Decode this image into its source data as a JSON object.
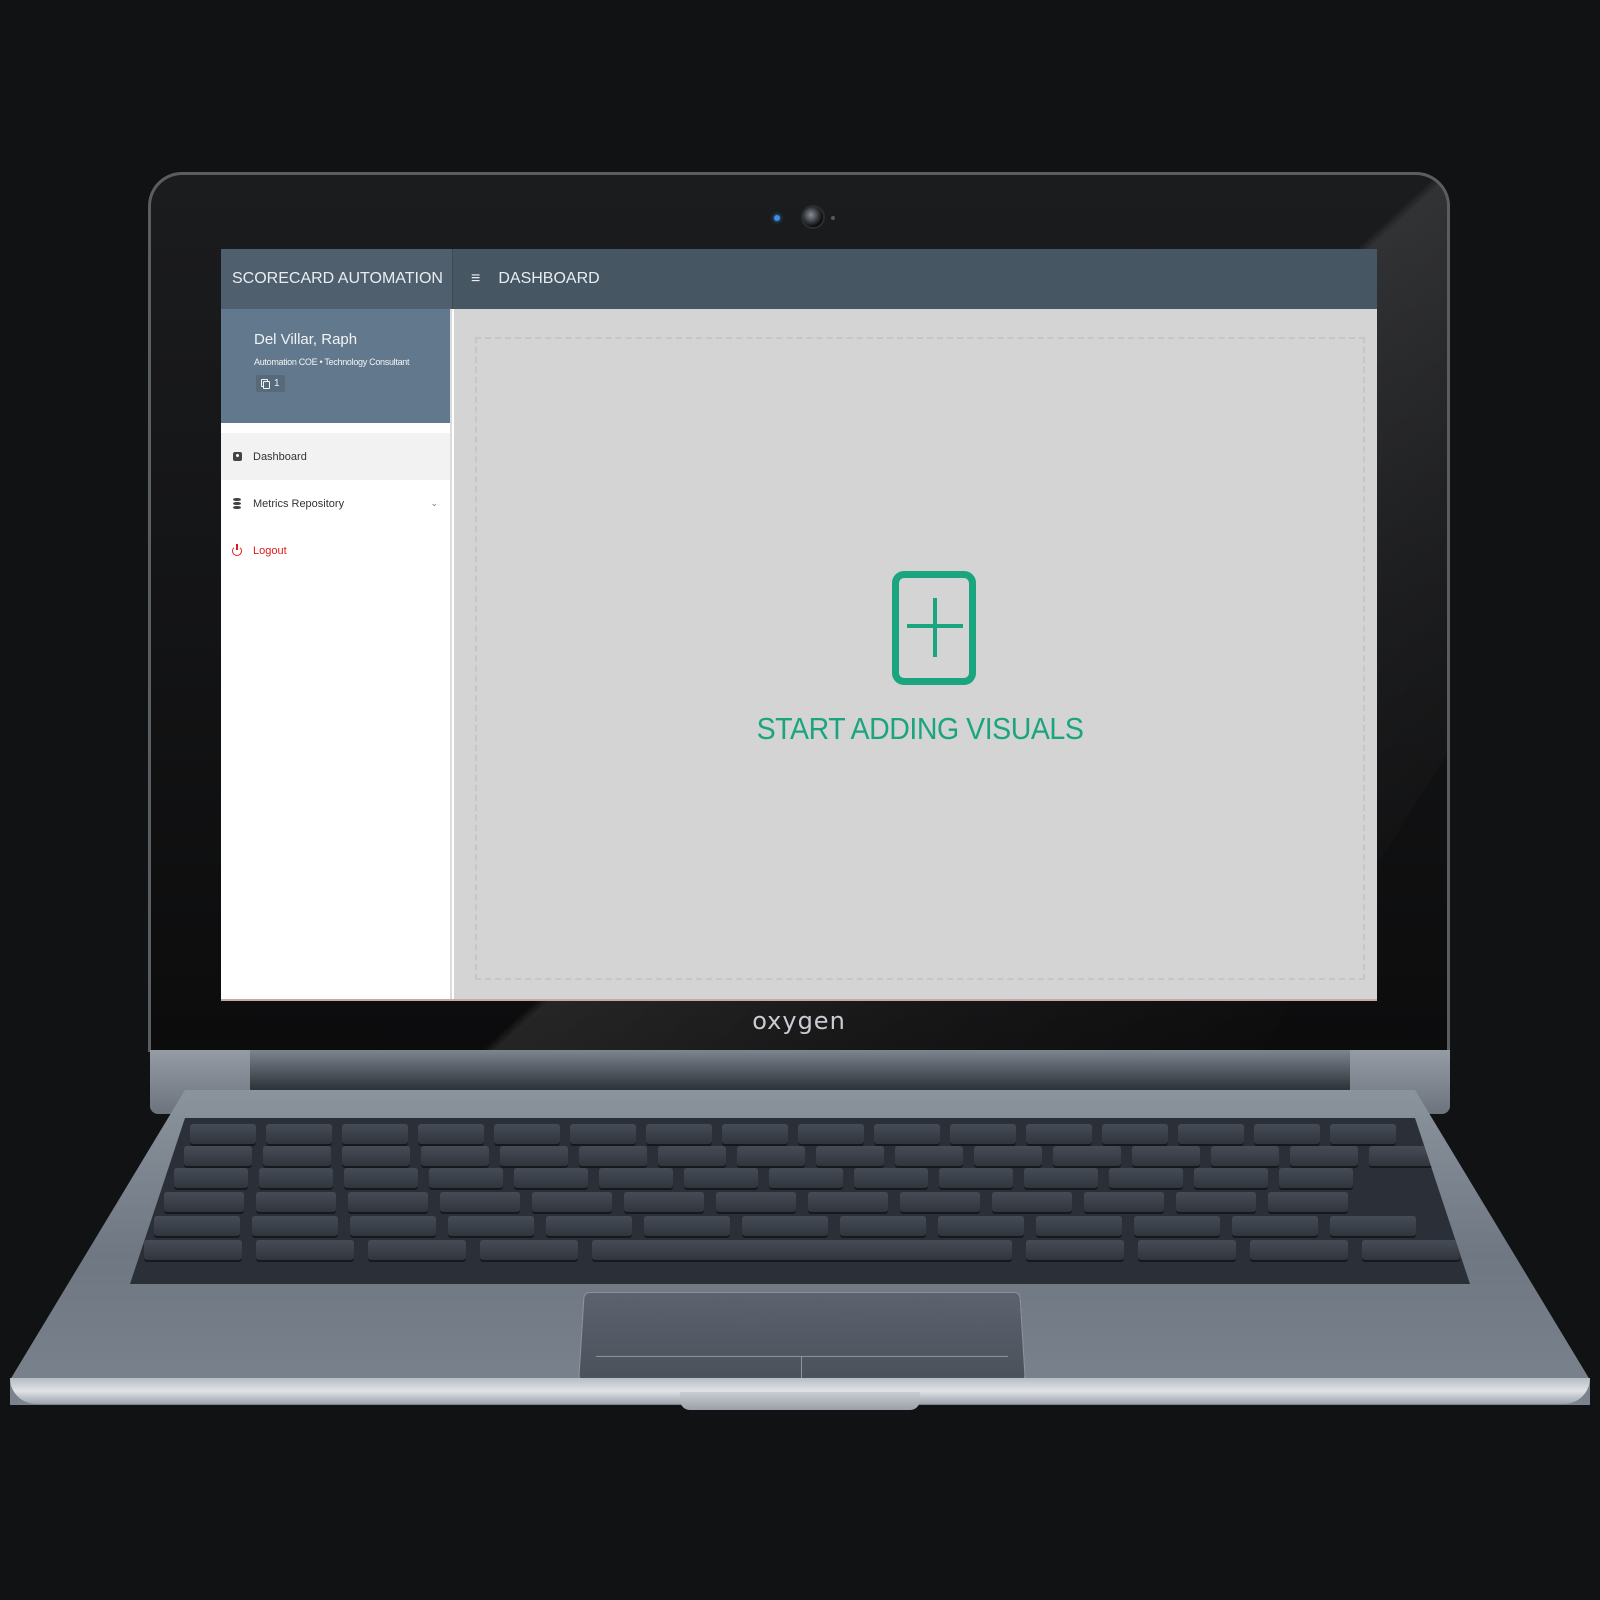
{
  "app": {
    "brand_title": "SCORECARD AUTOMATION",
    "page_title": "DASHBOARD",
    "menu_icon": "hamburger-icon"
  },
  "profile": {
    "name": "Del Villar, Raph",
    "role": "Automation COE • Technology Consultant",
    "badge_count": "1",
    "badge_icon": "copy-icon"
  },
  "sidebar": {
    "items": [
      {
        "label": "Dashboard",
        "icon": "dashboard-icon",
        "active": true
      },
      {
        "label": "Metrics Repository",
        "icon": "database-icon",
        "has_submenu": true
      },
      {
        "label": "Logout",
        "icon": "power-icon",
        "color": "#e01b1b"
      }
    ]
  },
  "main": {
    "cta_label": "START ADDING VISUALS",
    "cta_icon": "add-visual-icon",
    "accent": "#1aa57f"
  },
  "device": {
    "brand": "oxygen"
  }
}
